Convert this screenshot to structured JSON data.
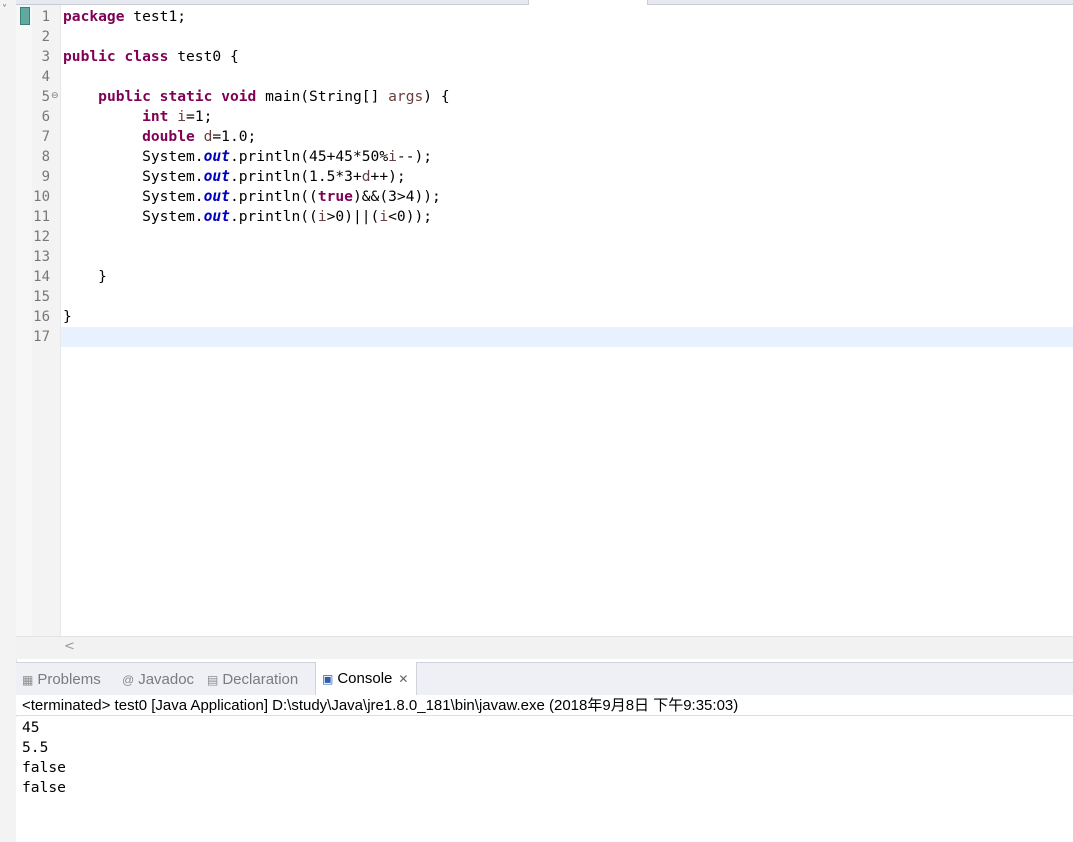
{
  "editor": {
    "line_numbers": [
      "1",
      "2",
      "3",
      "4",
      "5",
      "6",
      "7",
      "8",
      "9",
      "10",
      "11",
      "12",
      "13",
      "14",
      "15",
      "16",
      "17"
    ],
    "current_line": 17,
    "code": {
      "l1": {
        "kw": "package",
        "rest": " test1;"
      },
      "l3": {
        "kw1": "public",
        "kw2": "class",
        "rest": " test0 {"
      },
      "l5": {
        "kw1": "public",
        "kw2": "static",
        "kw3": "void",
        "mid": " main(String[] ",
        "var": "args",
        "end": ") {"
      },
      "l6": {
        "kw": "int",
        "var": "i",
        "end": "=1;"
      },
      "l7": {
        "kw": "double",
        "var": "d",
        "end": "=1.0;"
      },
      "l8": {
        "pre": "System.",
        "fld": "out",
        "mid": ".println(45+45*50%",
        "var": "i",
        "end": "--);"
      },
      "l9": {
        "pre": "System.",
        "fld": "out",
        "mid": ".println(1.5*3+",
        "var": "d",
        "end": "++);"
      },
      "l10": {
        "pre": "System.",
        "fld": "out",
        "mid": ".println((",
        "kw": "true",
        "end": ")&&(3>4));"
      },
      "l11": {
        "pre": "System.",
        "fld": "out",
        "mid": ".println((",
        "var1": "i",
        "mid2": ">0)||(",
        "var2": "i",
        "end": "<0));"
      },
      "l14": "}",
      "l16": "}"
    }
  },
  "views": {
    "tabs": [
      {
        "label": "Problems",
        "icon": "problems-icon"
      },
      {
        "label": "Javadoc",
        "icon": "at-icon"
      },
      {
        "label": "Declaration",
        "icon": "declaration-icon"
      },
      {
        "label": "Console",
        "icon": "console-icon",
        "active": true
      }
    ]
  },
  "console": {
    "header": "<terminated> test0 [Java Application] D:\\study\\Java\\jre1.8.0_181\\bin\\javaw.exe (2018年9月8日 下午9:35:03)",
    "output": [
      "45",
      "5.5",
      "false",
      "false"
    ]
  },
  "colors": {
    "keyword": "#7f0055",
    "local_variable": "#6a3e3e",
    "static_field": "#0000c0",
    "current_line_bg": "#e8f2fe",
    "quick_diff_marker": "#5eaaa0"
  }
}
